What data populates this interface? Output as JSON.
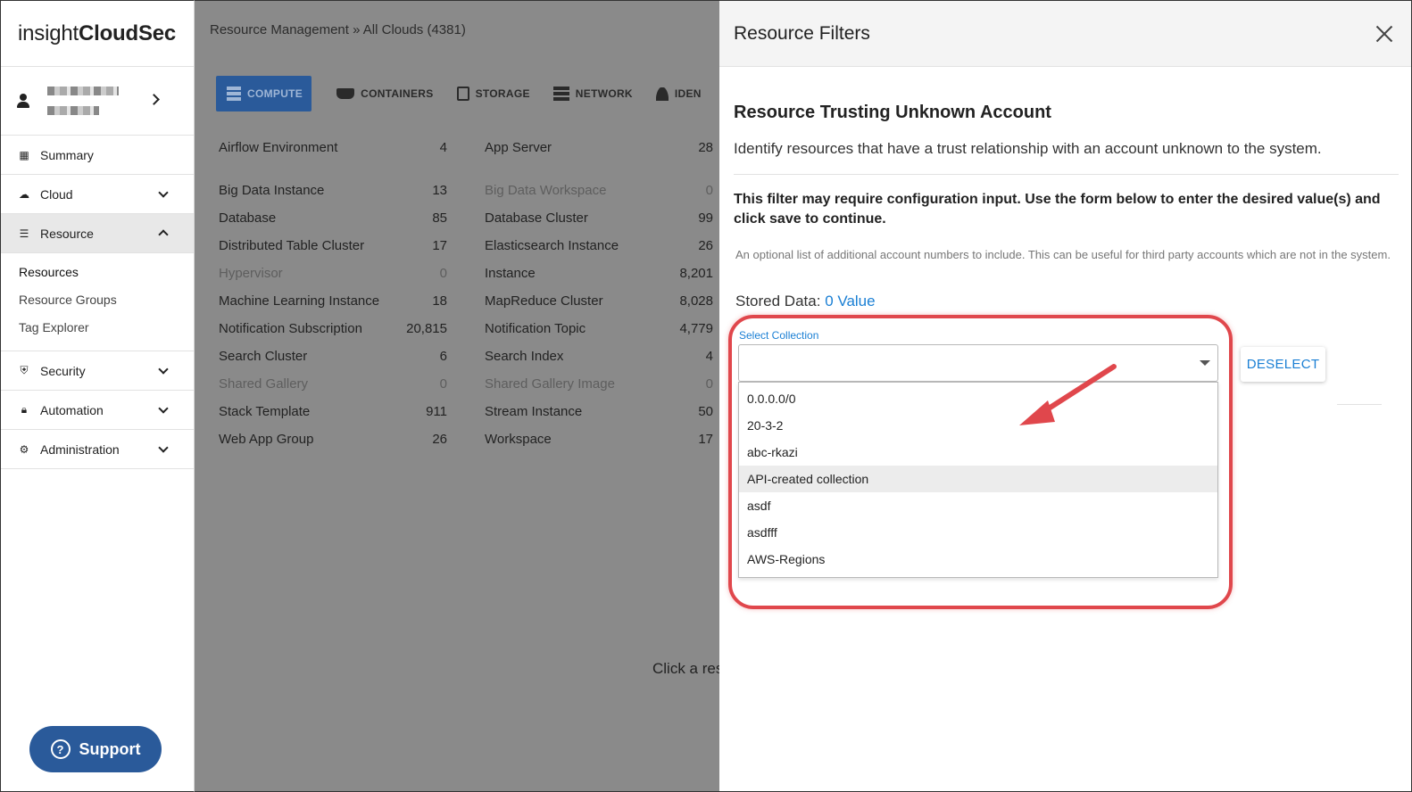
{
  "sidebar": {
    "brand_light": "insight",
    "brand_bold": "CloudSec",
    "nav": [
      {
        "label": "Summary",
        "icon": "grid-icon"
      },
      {
        "label": "Cloud",
        "icon": "cloud-icon"
      },
      {
        "label": "Resource",
        "icon": "list-icon"
      },
      {
        "label": "Security",
        "icon": "shield-icon"
      },
      {
        "label": "Automation",
        "icon": "lock-icon"
      },
      {
        "label": "Administration",
        "icon": "gear-icon"
      }
    ],
    "sub_items": [
      "Resources",
      "Resource Groups",
      "Tag Explorer"
    ],
    "support_label": "Support"
  },
  "main": {
    "breadcrumb": "Resource Management » All Clouds (4381)",
    "tabs": [
      "COMPUTE",
      "CONTAINERS",
      "STORAGE",
      "NETWORK",
      "IDEN"
    ],
    "col1": [
      {
        "name": "Airflow Environment",
        "count": "4"
      },
      {
        "name": "Big Data Instance",
        "count": "13"
      },
      {
        "name": "Database",
        "count": "85"
      },
      {
        "name": "Distributed Table Cluster",
        "count": "17"
      },
      {
        "name": "Hypervisor",
        "count": "0"
      },
      {
        "name": "Machine Learning Instance",
        "count": "18"
      },
      {
        "name": "Notification Subscription",
        "count": "20,815"
      },
      {
        "name": "Search Cluster",
        "count": "6"
      },
      {
        "name": "Shared Gallery",
        "count": "0"
      },
      {
        "name": "Stack Template",
        "count": "911"
      },
      {
        "name": "Web App Group",
        "count": "26"
      }
    ],
    "col2": [
      {
        "name": "App Server",
        "count": "28"
      },
      {
        "name": "Big Data Workspace",
        "count": "0"
      },
      {
        "name": "Database Cluster",
        "count": "99"
      },
      {
        "name": "Elasticsearch Instance",
        "count": "26"
      },
      {
        "name": "Instance",
        "count": "8,201"
      },
      {
        "name": "MapReduce Cluster",
        "count": "8,028"
      },
      {
        "name": "Notification Topic",
        "count": "4,779"
      },
      {
        "name": "Search Index",
        "count": "4"
      },
      {
        "name": "Shared Gallery Image",
        "count": "0"
      },
      {
        "name": "Stream Instance",
        "count": "50"
      },
      {
        "name": "Workspace",
        "count": "17"
      }
    ],
    "click_message": "Click a res"
  },
  "panel": {
    "header": "Resource Filters",
    "filter_title": "Resource Trusting Unknown Account",
    "filter_desc": "Identify resources that have a trust relationship with an account unknown to the system.",
    "warning": "This filter may require configuration input. Use the form below to enter the desired value(s) and click save to continue.",
    "help_text": "An optional list of additional account numbers to include. This can be useful for third party accounts which are not in the system.",
    "stored_label": "Stored Data:",
    "stored_value": "0 Value",
    "select_label": "Select Collection",
    "options": [
      "0.0.0.0/0",
      "20-3-2",
      "abc-rkazi",
      "API-created collection",
      "asdf",
      "asdfff",
      "AWS-Regions"
    ],
    "highlighted_option": "API-created collection",
    "deselect_label": "DESELECT"
  },
  "colors": {
    "accent": "#2a5a9a",
    "link": "#1a7fd4",
    "annotation": "#e0474c"
  }
}
